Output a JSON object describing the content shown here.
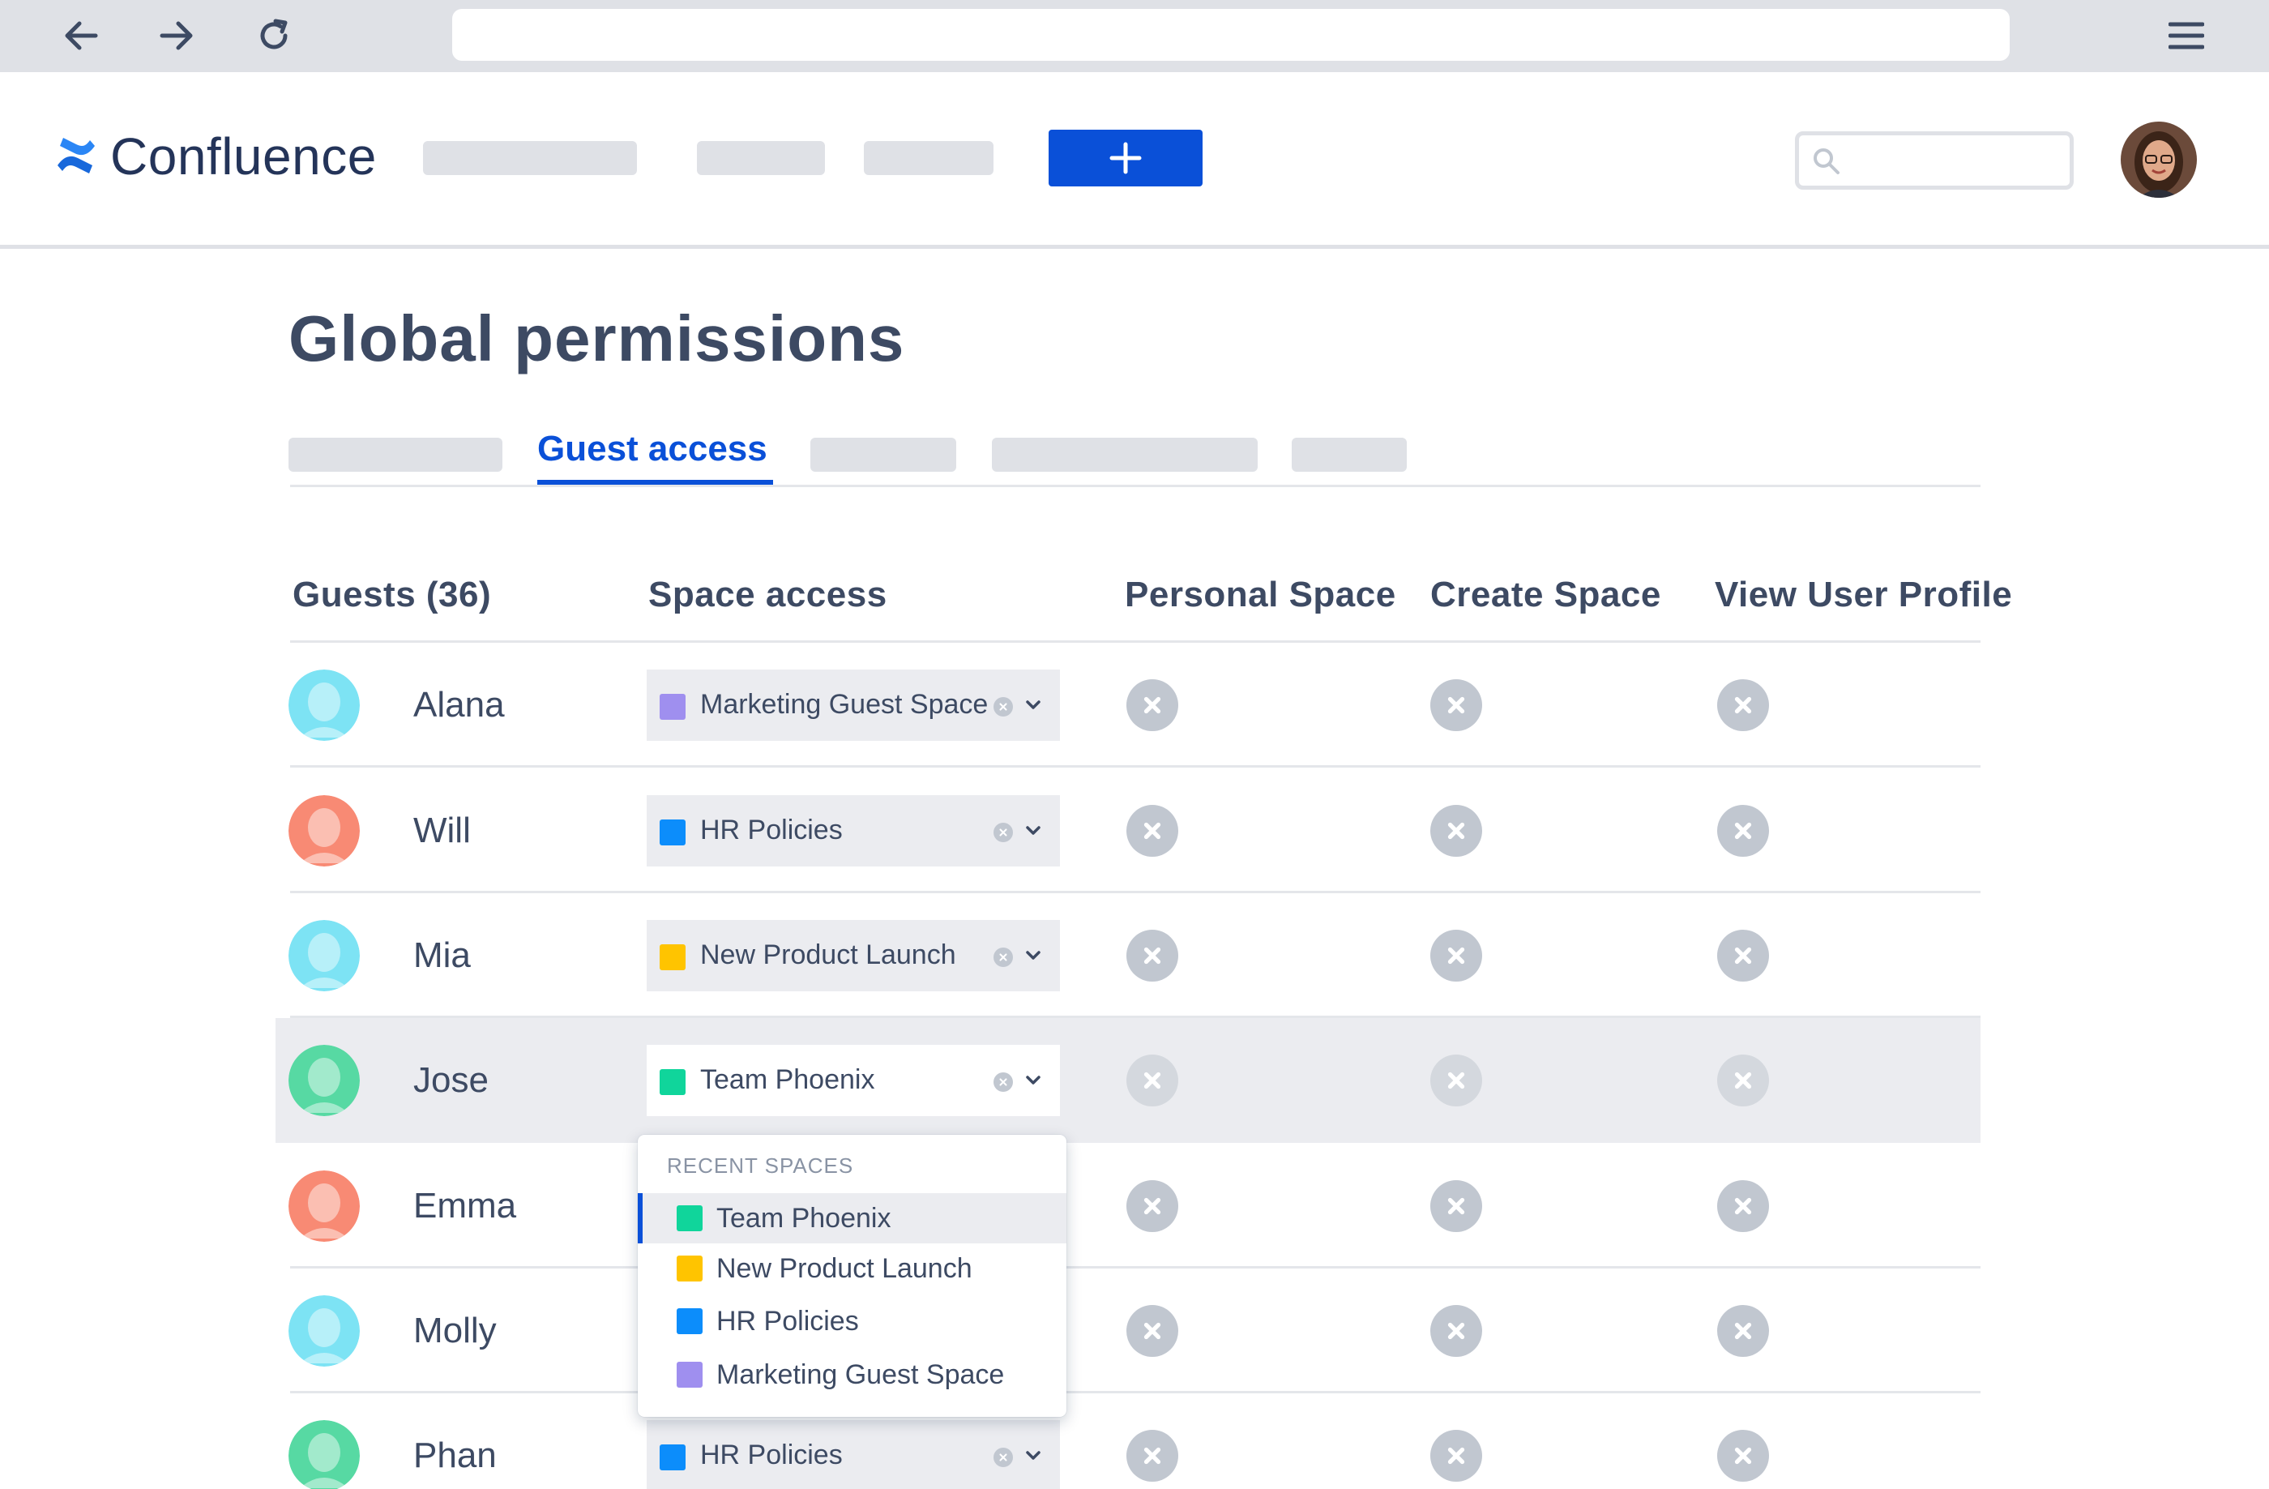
{
  "browser": {
    "back_icon": "arrow-left-icon",
    "forward_icon": "arrow-right-icon",
    "reload_icon": "reload-icon",
    "menu_icon": "hamburger-menu-icon",
    "url": ""
  },
  "app": {
    "name": "Confluence",
    "logo_icon": "confluence-logo-icon",
    "create_icon": "plus-icon",
    "search_icon": "search-icon",
    "accent_color": "#0a50d8"
  },
  "page": {
    "title": "Global permissions",
    "active_tab": "Guest access"
  },
  "table": {
    "headers": {
      "guests": "Guests (36)",
      "space_access": "Space access",
      "personal_space": "Personal Space",
      "create_space": "Create Space",
      "view_user_profile": "View User Profile"
    },
    "rows": [
      {
        "name": "Alana",
        "avatar_color": "#7de3f4",
        "space": "Marketing Guest Space",
        "space_color": "#9f8fef",
        "personal_space": false,
        "create_space": false,
        "view_user_profile": false
      },
      {
        "name": "Will",
        "avatar_color": "#f88a74",
        "space": "HR Policies",
        "space_color": "#0c8dfb",
        "personal_space": false,
        "create_space": false,
        "view_user_profile": false
      },
      {
        "name": "Mia",
        "avatar_color": "#7de3f4",
        "space": "New Product Launch",
        "space_color": "#ffc400",
        "personal_space": false,
        "create_space": false,
        "view_user_profile": false
      },
      {
        "name": "Jose",
        "avatar_color": "#57d9a3",
        "space": "Team Phoenix",
        "space_color": "#10d59b",
        "personal_space": false,
        "create_space": false,
        "view_user_profile": false
      },
      {
        "name": "Emma",
        "avatar_color": "#f88a74",
        "space": "",
        "space_color": "",
        "personal_space": false,
        "create_space": false,
        "view_user_profile": false
      },
      {
        "name": "Molly",
        "avatar_color": "#7de3f4",
        "space": "",
        "space_color": "",
        "personal_space": false,
        "create_space": false,
        "view_user_profile": false
      },
      {
        "name": "Phan",
        "avatar_color": "#57d9a3",
        "space": "HR Policies",
        "space_color": "#0c8dfb",
        "personal_space": false,
        "create_space": false,
        "view_user_profile": false
      }
    ]
  },
  "dropdown": {
    "heading": "RECENT SPACES",
    "items": [
      {
        "label": "Team Phoenix",
        "color": "#10d59b",
        "selected": true
      },
      {
        "label": "New Product Launch",
        "color": "#ffc400",
        "selected": false
      },
      {
        "label": "HR Policies",
        "color": "#0c8dfb",
        "selected": false
      },
      {
        "label": "Marketing Guest Space",
        "color": "#9f8fef",
        "selected": false
      }
    ]
  }
}
